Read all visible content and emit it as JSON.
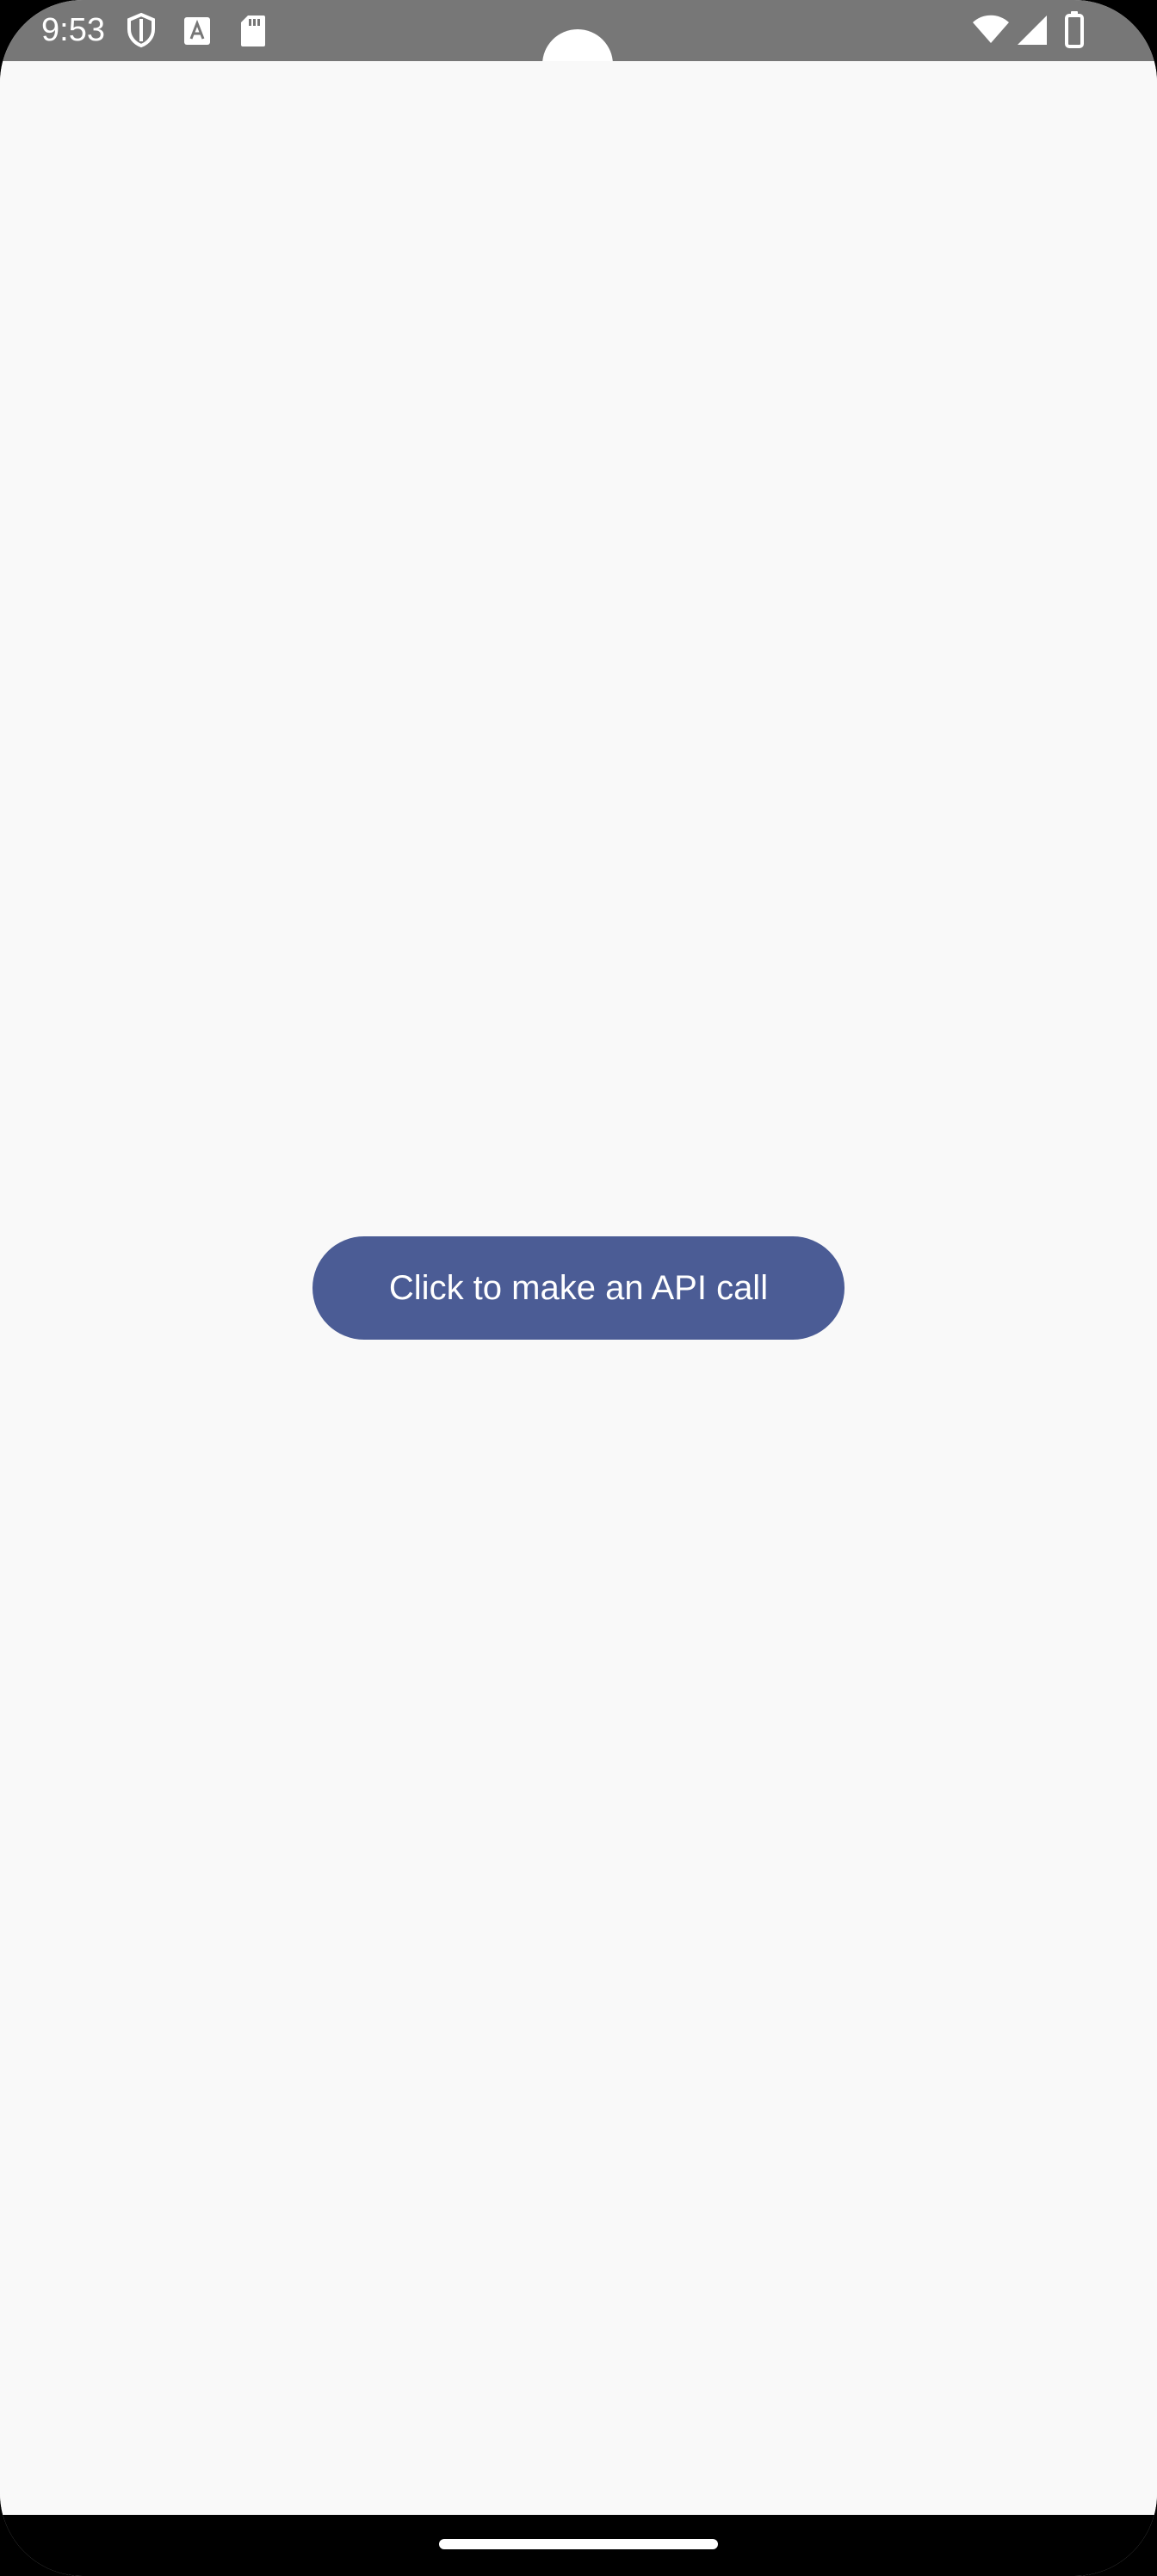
{
  "status_bar": {
    "time": "9:53",
    "left_icons": [
      "shield-icon",
      "text-a-icon",
      "sd-card-icon"
    ],
    "right_icons": [
      "wifi-icon",
      "cellular-signal-icon",
      "battery-icon"
    ]
  },
  "main": {
    "button_label": "Click to make an API call"
  },
  "colors": {
    "status_bar": "#777777",
    "background": "#f9f9f9",
    "button": "#4b5c95",
    "button_text": "#ffffff",
    "nav_bar": "#000000"
  }
}
